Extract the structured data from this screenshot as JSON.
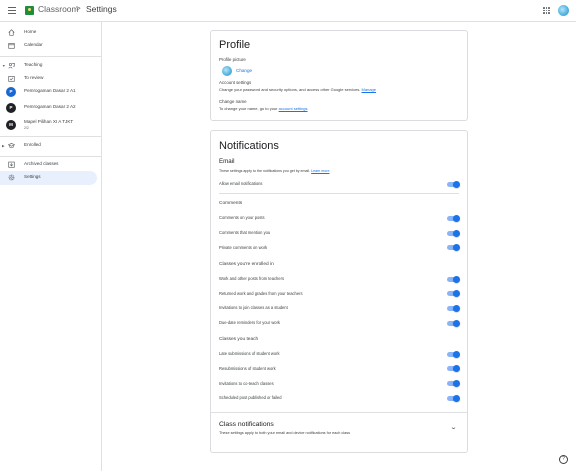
{
  "header": {
    "app_name": "Classroom",
    "separator": ">",
    "page": "Settings"
  },
  "sidebar": {
    "home": "Home",
    "calendar": "Calendar",
    "teaching": "Teaching",
    "to_review": "To review",
    "classes": [
      {
        "initial": "P",
        "name": "Pemrogaman Dasar 2 A1",
        "color": "#1967d2"
      },
      {
        "initial": "P",
        "name": "Pemrogaman Dasar 2 A2",
        "color": "#202124"
      },
      {
        "initial": "M",
        "name": "Mapel Pilihan XI A TJKT",
        "sub": "2/2",
        "color": "#202124"
      }
    ],
    "enrolled": "Enrolled",
    "archived": "Archived classes",
    "settings": "Settings"
  },
  "profile": {
    "title": "Profile",
    "picture_label": "Profile picture",
    "change": "Change",
    "account_heading": "Account settings",
    "account_text": "Change your password and security options, and access other Google services.",
    "manage": "Manage",
    "name_heading": "Change name",
    "name_text": "To change your name, go to your",
    "name_link": "account settings"
  },
  "notifications": {
    "title": "Notifications",
    "email_heading": "Email",
    "email_text": "These settings apply to the notifications you get by email.",
    "learn_more": "Learn more",
    "allow_email": "Allow email notifications",
    "comments_heading": "Comments",
    "comments": [
      "Comments on your posts",
      "Comments that mention you",
      "Private comments on work"
    ],
    "enrolled_heading": "Classes you're enrolled in",
    "enrolled": [
      "Work and other posts from teachers",
      "Returned work and grades from your teachers",
      "Invitations to join classes as a student",
      "Due-date reminders for your work"
    ],
    "teach_heading": "Classes you teach",
    "teach": [
      "Late submissions of student work",
      "Resubmissions of student work",
      "Invitations to co-teach classes",
      "Scheduled post published or failed"
    ]
  },
  "class_notifications": {
    "title": "Class notifications",
    "text": "These settings apply to both your email and device notifications for each class"
  },
  "help": "?",
  "colors": {
    "accent": "#1a73e8",
    "toggle_track": "#8ab4f8",
    "logo": "#1e8e3e"
  }
}
